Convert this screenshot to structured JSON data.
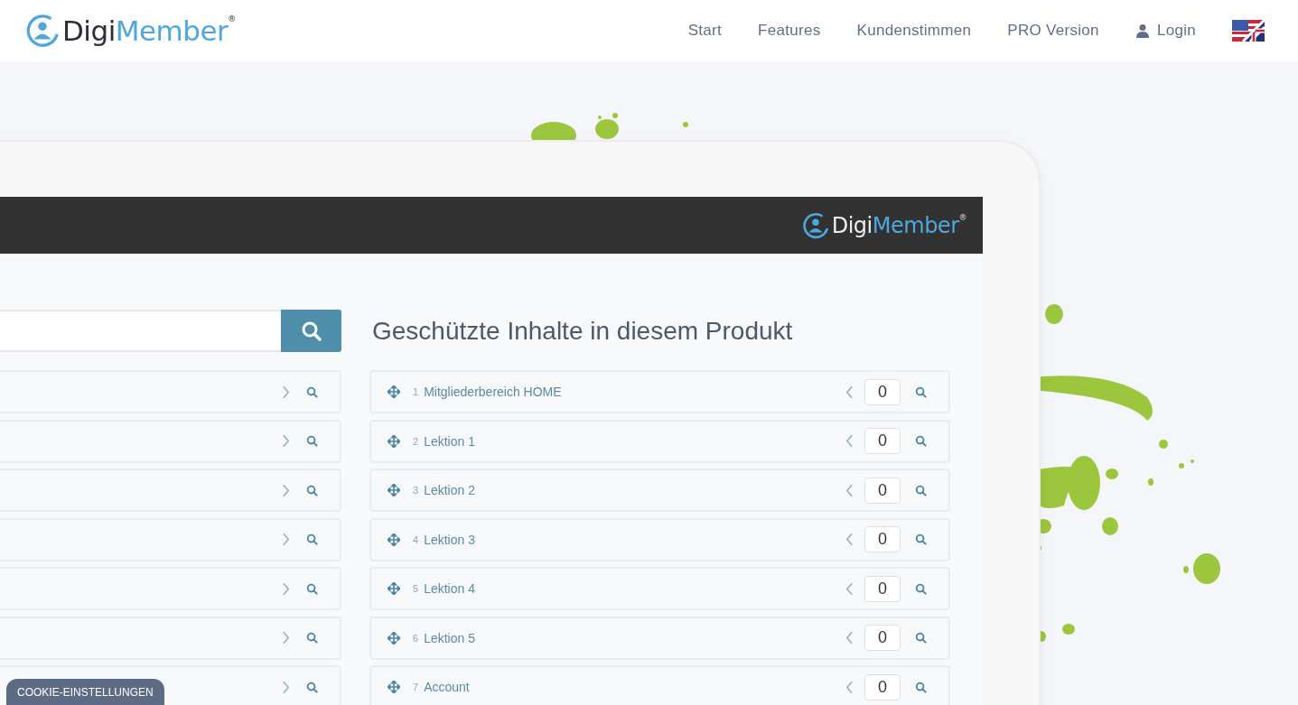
{
  "header": {
    "logo": {
      "dark": "Digi",
      "accent": "Member",
      "mark": "®"
    },
    "nav": [
      {
        "label": "Start",
        "kind": "link"
      },
      {
        "label": "Features",
        "kind": "link"
      },
      {
        "label": "Kundenstimmen",
        "kind": "link"
      },
      {
        "label": "PRO Version",
        "kind": "link"
      },
      {
        "label": "Login",
        "kind": "login"
      }
    ]
  },
  "app": {
    "logo": {
      "dark": "Digi",
      "accent": "Member",
      "mark": "®"
    },
    "title": "Geschützte Inhalte in diesem Produkt",
    "items": [
      {
        "number": "1",
        "label": "Mitgliederbereich HOME",
        "value": "0"
      },
      {
        "number": "2",
        "label": "Lektion 1",
        "value": "0"
      },
      {
        "number": "3",
        "label": "Lektion 2",
        "value": "0"
      },
      {
        "number": "4",
        "label": "Lektion 3",
        "value": "0"
      },
      {
        "number": "5",
        "label": "Lektion 4",
        "value": "0"
      },
      {
        "number": "6",
        "label": "Lektion 5",
        "value": "0"
      },
      {
        "number": "7",
        "label": "Account",
        "value": "0"
      }
    ]
  },
  "cookie_button": "COOKIE-EINSTELLUNGEN"
}
